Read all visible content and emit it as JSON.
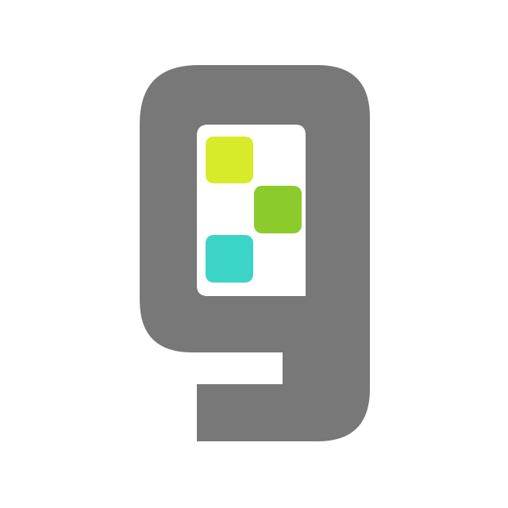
{
  "logo": {
    "icon": "stylized-letter-g-logo-icon",
    "colors": {
      "background": "#ffffff",
      "glyph": "#787878",
      "square_top": "#d7eb2b",
      "square_middle": "#8bcc2c",
      "square_bottom": "#3dd4c8"
    }
  }
}
